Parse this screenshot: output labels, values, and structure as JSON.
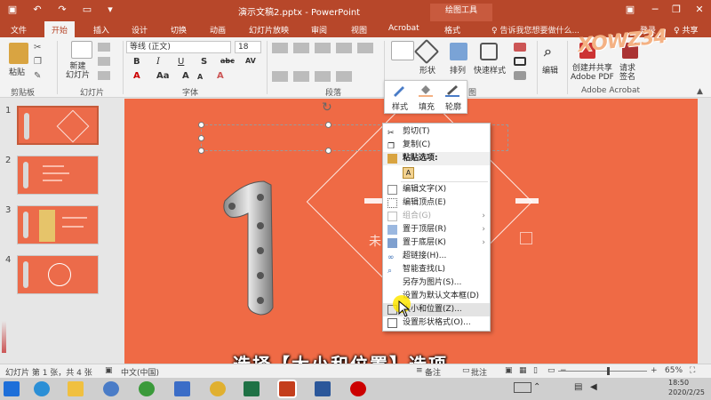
{
  "window": {
    "title": "演示文稿2.pptx - PowerPoint",
    "context_tab_group": "绘图工具",
    "colors": {
      "accent": "#b7472a",
      "slide_bg": "#ef6a45",
      "ribbon_bg": "#f3f3f3"
    }
  },
  "tabs": [
    {
      "label": "文件"
    },
    {
      "label": "开始",
      "active": true
    },
    {
      "label": "插入"
    },
    {
      "label": "设计"
    },
    {
      "label": "切换"
    },
    {
      "label": "动画"
    },
    {
      "label": "幻灯片放映"
    },
    {
      "label": "审阅"
    },
    {
      "label": "视图"
    },
    {
      "label": "Acrobat"
    },
    {
      "label": "格式"
    }
  ],
  "tell_me": "♀ 告诉我您想要做什么...",
  "login": "登录",
  "share": "♀ 共享",
  "ribbon": {
    "paste": "粘贴",
    "clipboard_group": "剪贴板",
    "new_slide": "新建\n幻灯片",
    "slides_group": "幻灯片",
    "font_name": "等线 (正文)",
    "font_size": "18",
    "font_group": "字体",
    "paragraph_group": "段落",
    "shape_btn": "形状",
    "arrange_btn": "排列",
    "quick_style_btn": "快速样式",
    "edit_btn": "编辑",
    "create_pdf_btn": "创建并共享\nAdobe PDF",
    "request_sign_btn": "请求\n签名",
    "acrobat_group": "Adobe Acrobat",
    "drawing_group_partial": "图"
  },
  "mini_toolbar": {
    "style": "样式",
    "fill": "填充",
    "outline": "轮廓"
  },
  "context_menu": [
    {
      "label": "剪切(T)",
      "icon": "scissors-icon"
    },
    {
      "label": "复制(C)",
      "icon": "copy-icon"
    },
    {
      "label": "粘贴选项:",
      "icon": "paste-icon",
      "header": true
    },
    {
      "label": "",
      "icon": "paste-keep-text-icon",
      "paste_opt": true
    },
    {
      "label": "编辑文字(X)",
      "icon": "edit-text-icon"
    },
    {
      "label": "编辑顶点(E)",
      "icon": "edit-points-icon"
    },
    {
      "label": "组合(G)",
      "icon": "group-icon",
      "disabled": true,
      "submenu": true
    },
    {
      "label": "置于顶层(R)",
      "icon": "bring-front-icon",
      "submenu": true
    },
    {
      "label": "置于底层(K)",
      "icon": "send-back-icon",
      "submenu": true
    },
    {
      "label": "超链接(H)...",
      "icon": "hyperlink-icon"
    },
    {
      "label": "智能查找(L)",
      "icon": "smart-lookup-icon"
    },
    {
      "label": "另存为图片(S)...",
      "icon": ""
    },
    {
      "label": "设置为默认文本框(D)",
      "icon": ""
    },
    {
      "label": "大小和位置(Z)...",
      "icon": "size-position-icon",
      "highlight": true
    },
    {
      "label": "设置形状格式(O)...",
      "icon": "format-shape-icon"
    }
  ],
  "slides": [
    {
      "num": "1",
      "selected": true
    },
    {
      "num": "2"
    },
    {
      "num": "3"
    },
    {
      "num": "4"
    }
  ],
  "slide_text": {
    "first_char": "未"
  },
  "caption": "选择【大小和位置】选项",
  "status": {
    "slide_info": "幻灯片 第 1 张，共 4 张",
    "language": "中文(中国)",
    "notes": "备注",
    "comments": "批注",
    "zoom": "65%"
  },
  "taskbar": {
    "date": "2020/2/25",
    "time": "18:50"
  },
  "watermark": "XOWZ34"
}
